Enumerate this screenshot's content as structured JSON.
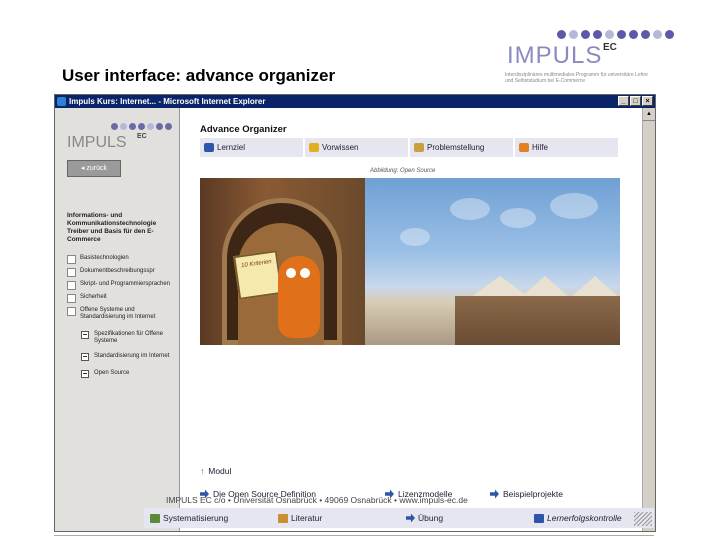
{
  "slide": {
    "title": "User interface: advance organizer",
    "logo_text": "IMPULS",
    "logo_ec": "EC",
    "logo_sub": "Interdisziplinäres multimediales Programm für universitäre Lehre und Selbststudium bei E-Commerce",
    "footer": "IMPULS EC c/o  •  Universität Osnabrück  •  49069 Osnabrück  •  www.impuls-ec.de"
  },
  "window": {
    "title": "Impuls Kurs: Internet... - Microsoft Internet Explorer",
    "min": "_",
    "max": "□",
    "close": "×"
  },
  "sidebar": {
    "logo_text": "IMPULS",
    "logo_ec": "EC",
    "back_label": "zurück",
    "heading": "Informations- und Kommunikationstechnologie Treiber und Basis für den E-Commerce",
    "items": [
      {
        "label": "Basistechnologien"
      },
      {
        "label": "Dokumentbeschreibungsspr"
      },
      {
        "label": "Skript- und Programmiersprachen"
      },
      {
        "label": "Sicherheit"
      },
      {
        "label": "Offene Systeme und Standardisierung im Internet"
      }
    ],
    "subitems": [
      {
        "label": "Spezifikationen für Offene Systeme"
      },
      {
        "label": "Standardisierung im Internet"
      },
      {
        "label": "Open Source"
      }
    ]
  },
  "main": {
    "title": "Advance Organizer",
    "tabs": [
      {
        "label": "Lernziel",
        "icon": "target-icon",
        "color": "#2e56a8"
      },
      {
        "label": "Vorwissen",
        "icon": "lightbulb-icon",
        "color": "#e0b020"
      },
      {
        "label": "Problemstellung",
        "icon": "owl-icon",
        "color": "#c8a040"
      },
      {
        "label": "Hilfe",
        "icon": "help-icon",
        "color": "#e08020"
      }
    ],
    "caption": "Abbildung: Open Source",
    "sign_text": "10 Kriterien",
    "module_label": "Modul",
    "links": [
      {
        "label": "Die Open Source Definition"
      },
      {
        "label": "Lizenzmodelle"
      },
      {
        "label": "Beispielprojekte"
      }
    ],
    "bottom": [
      {
        "label": "Systematisierung"
      },
      {
        "label": "Literatur"
      },
      {
        "label": "Übung"
      },
      {
        "label": "Lernerfolgskontrolle"
      }
    ]
  },
  "colors": {
    "titlebar": "#0a246a",
    "nav_bg": "#e6e6f0",
    "accent": "#2e56a8"
  }
}
